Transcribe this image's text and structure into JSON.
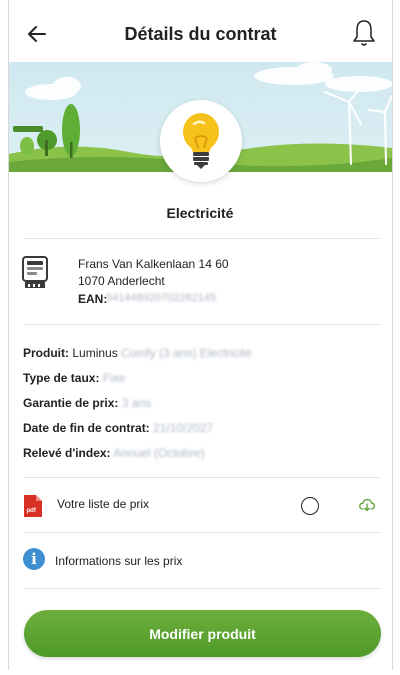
{
  "header": {
    "title": "Détails du contrat",
    "back_icon": "arrow-left-icon",
    "bell_icon": "bell-icon"
  },
  "banner": {
    "illustration": "landscape-with-trees-and-wind-turbines",
    "central_icon": "lightbulb-icon"
  },
  "contract": {
    "service": "Electricité",
    "address_line1": "Frans Van Kalkenlaan 14 60",
    "address_line2": "1070 Anderlecht",
    "ean_label": "EAN:",
    "ean_value": "541448920702262145"
  },
  "details": [
    {
      "label": "Produit:",
      "value": "Luminus",
      "value_blurred": "Comfy (3 ans) Electricité"
    },
    {
      "label": "Type de taux:",
      "value": "",
      "value_blurred": "Fixe"
    },
    {
      "label": "Garantie de prix:",
      "value": "",
      "value_blurred": "3 ans"
    },
    {
      "label": "Date de fin de contrat:",
      "value": "",
      "value_blurred": "21/10/2027"
    },
    {
      "label": "Relevé d'index:",
      "value": "",
      "value_blurred": "Annuel (Octobre)"
    }
  ],
  "price_list": {
    "label": "Votre liste de prix",
    "file_icon": "pdf-file-icon",
    "download_icon": "cloud-download-icon"
  },
  "price_info": {
    "label": "Informations sur les prix",
    "icon": "info-icon"
  },
  "cta": {
    "label": "Modifier produit"
  },
  "colors": {
    "brand_green": "#5aa232",
    "info_blue": "#3d8fd1",
    "pdf_red": "#d93025",
    "sky": "#d5ecf1"
  }
}
